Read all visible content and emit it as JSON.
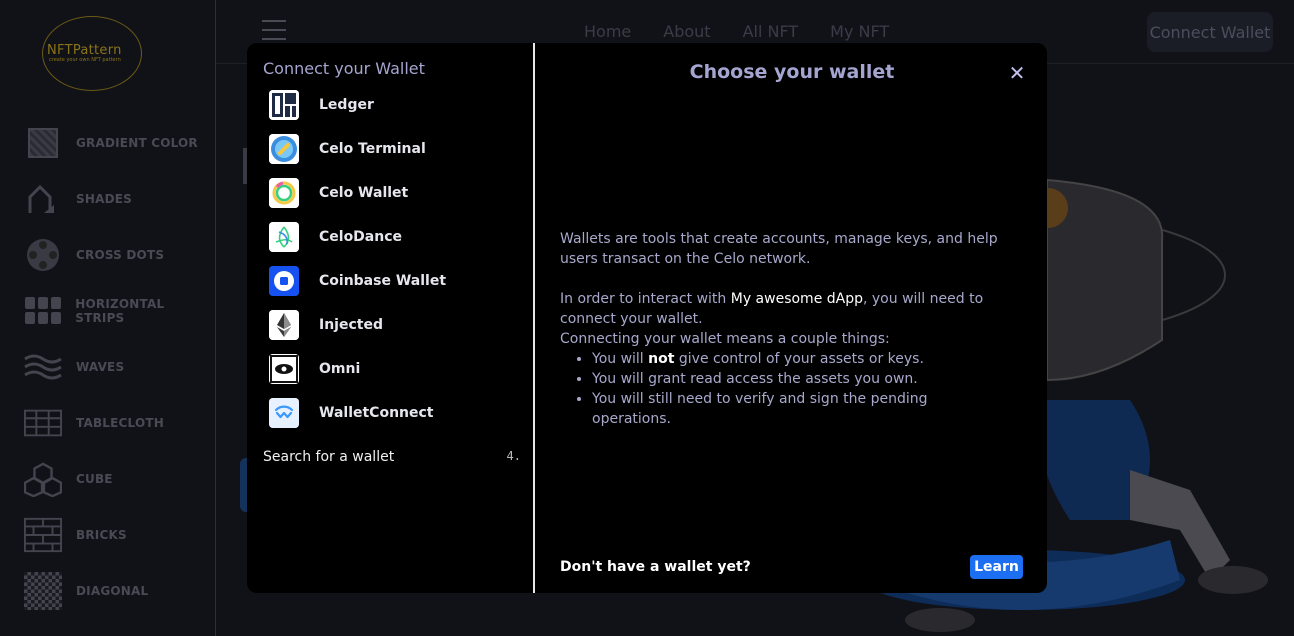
{
  "background": {
    "logo": {
      "title": "NFTPattern",
      "tagline": "create your own NFT pattern"
    },
    "sidebar": [
      {
        "label": "GRADIENT COLOR",
        "icon": "gradient-color-icon"
      },
      {
        "label": "SHADES",
        "icon": "shades-icon"
      },
      {
        "label": "CROSS DOTS",
        "icon": "cross-dots-icon"
      },
      {
        "label": "HORIZONTAL STRIPS",
        "icon": "horizontal-strips-icon"
      },
      {
        "label": "WAVES",
        "icon": "waves-icon"
      },
      {
        "label": "TABLECLOTH",
        "icon": "tablecloth-icon"
      },
      {
        "label": "CUBE",
        "icon": "cube-icon"
      },
      {
        "label": "BRICKS",
        "icon": "bricks-icon"
      },
      {
        "label": "DIAGONAL",
        "icon": "diagonal-icon"
      }
    ],
    "nav": [
      "Home",
      "About",
      "All NFT",
      "My NFT"
    ],
    "connect_wallet": "Connect Wallet"
  },
  "modal": {
    "left_title": "Connect your Wallet",
    "wallets": [
      {
        "name": "Ledger",
        "icon": "ledger-icon"
      },
      {
        "name": "Celo Terminal",
        "icon": "celo-terminal-icon"
      },
      {
        "name": "Celo Wallet",
        "icon": "celo-wallet-icon"
      },
      {
        "name": "CeloDance",
        "icon": "celodance-icon"
      },
      {
        "name": "Coinbase Wallet",
        "icon": "coinbase-wallet-icon"
      },
      {
        "name": "Injected",
        "icon": "ethereum-icon"
      },
      {
        "name": "Omni",
        "icon": "omni-icon"
      },
      {
        "name": "WalletConnect",
        "icon": "walletconnect-icon"
      }
    ],
    "search_label": "Search for a wallet",
    "search_shortcut": "4.",
    "right_title": "Choose your wallet",
    "close": "✕",
    "desc1": "Wallets are tools that create accounts, manage keys, and help users transact on the Celo network.",
    "desc2_prefix": "In order to interact with ",
    "desc2_app": "My awesome dApp",
    "desc2_suffix": ", you will need to connect your wallet.",
    "desc3": "Connecting your wallet means a couple things:",
    "bullet1_prefix": "You will ",
    "bullet1_bold": "not",
    "bullet1_suffix": " give control of your assets or keys.",
    "bullet2": "You will grant read access the assets you own.",
    "bullet3": "You will still need to verify and sign the pending operations.",
    "footer_question": "Don't have a wallet yet?",
    "learn": "Learn"
  }
}
